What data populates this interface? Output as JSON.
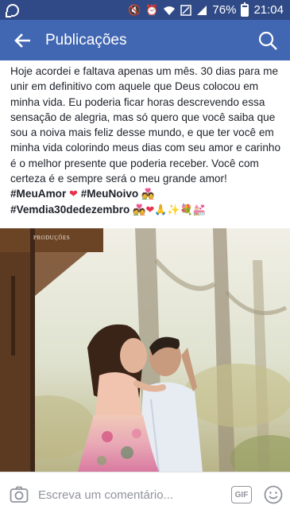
{
  "status_bar": {
    "battery_percent": "76%",
    "battery_level": 0.76,
    "time": "21:04",
    "icons": [
      "whatsapp-icon",
      "mute-icon",
      "alarm-icon",
      "wifi-icon",
      "signal-icon",
      "battery-icon"
    ]
  },
  "app_bar": {
    "title": "Publicações",
    "bg_color": "#4267b2"
  },
  "post": {
    "body": "Hoje acordei e faltava apenas um mês. 30 dias para me unir em definitivo com aquele que Deus colocou em minha vida. Eu poderia ficar horas descrevendo essa sensação de alegria, mas só quero que você saiba que sou a noiva mais feliz desse mundo, e que ter você em minha vida colorindo meus dias com seu amor e carinho é o melhor presente que poderia receber. Você com certeza é e sempre será o meu grande amor!",
    "tag1": "#MeuAmor",
    "tag2": "#MeuNoivo",
    "tag3": "#Vemdia30dedezembro",
    "emoji_heart": "❤",
    "emoji_couple": "💑",
    "emoji_pray": "🙏",
    "emoji_sparkle": "✨",
    "emoji_bouquet": "💐",
    "emoji_church": "💒",
    "photo_watermark": "PRODUÇÕES"
  },
  "comment_bar": {
    "placeholder": "Escreva um comentário...",
    "gif_label": "GIF"
  }
}
